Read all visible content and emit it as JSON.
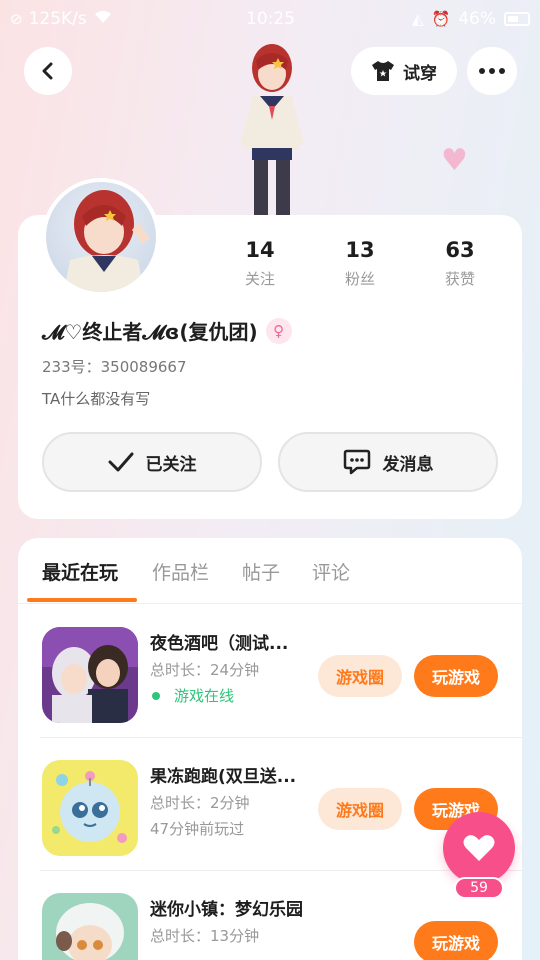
{
  "status_bar": {
    "speed": "125K/s",
    "time": "10:25",
    "battery": "46%"
  },
  "header": {
    "tryon_label": "试穿"
  },
  "profile": {
    "stats": [
      {
        "num": "14",
        "label": "关注"
      },
      {
        "num": "13",
        "label": "粉丝"
      },
      {
        "num": "63",
        "label": "获赞"
      }
    ],
    "username": "𝓜♡终止者𝓜ɞ(复仇团)",
    "uid": "233号：350089667",
    "bio": "TA什么都没有写",
    "follow_label": "已关注",
    "message_label": "发消息"
  },
  "tabs": [
    {
      "label": "最近在玩",
      "active": true
    },
    {
      "label": "作品栏",
      "active": false
    },
    {
      "label": "帖子",
      "active": false
    },
    {
      "label": "评论",
      "active": false
    }
  ],
  "games": [
    {
      "title": "夜色酒吧（测试...",
      "duration": "总时长：24分钟",
      "status": "游戏在线",
      "online": true,
      "circle_label": "游戏圈",
      "play_label": "玩游戏"
    },
    {
      "title": "果冻跑跑(双旦送...",
      "duration": "总时长：2分钟",
      "status": "47分钟前玩过",
      "online": false,
      "circle_label": "游戏圈",
      "play_label": "玩游戏"
    },
    {
      "title": "迷你小镇：梦幻乐园",
      "duration": "总时长：13分钟",
      "status": "",
      "online": false,
      "circle_label": "",
      "play_label": "玩游戏"
    }
  ],
  "like_fab": {
    "count": "59"
  },
  "colors": {
    "accent": "#ff7a1a",
    "like": "#f74f8a",
    "online": "#2fc57a"
  }
}
